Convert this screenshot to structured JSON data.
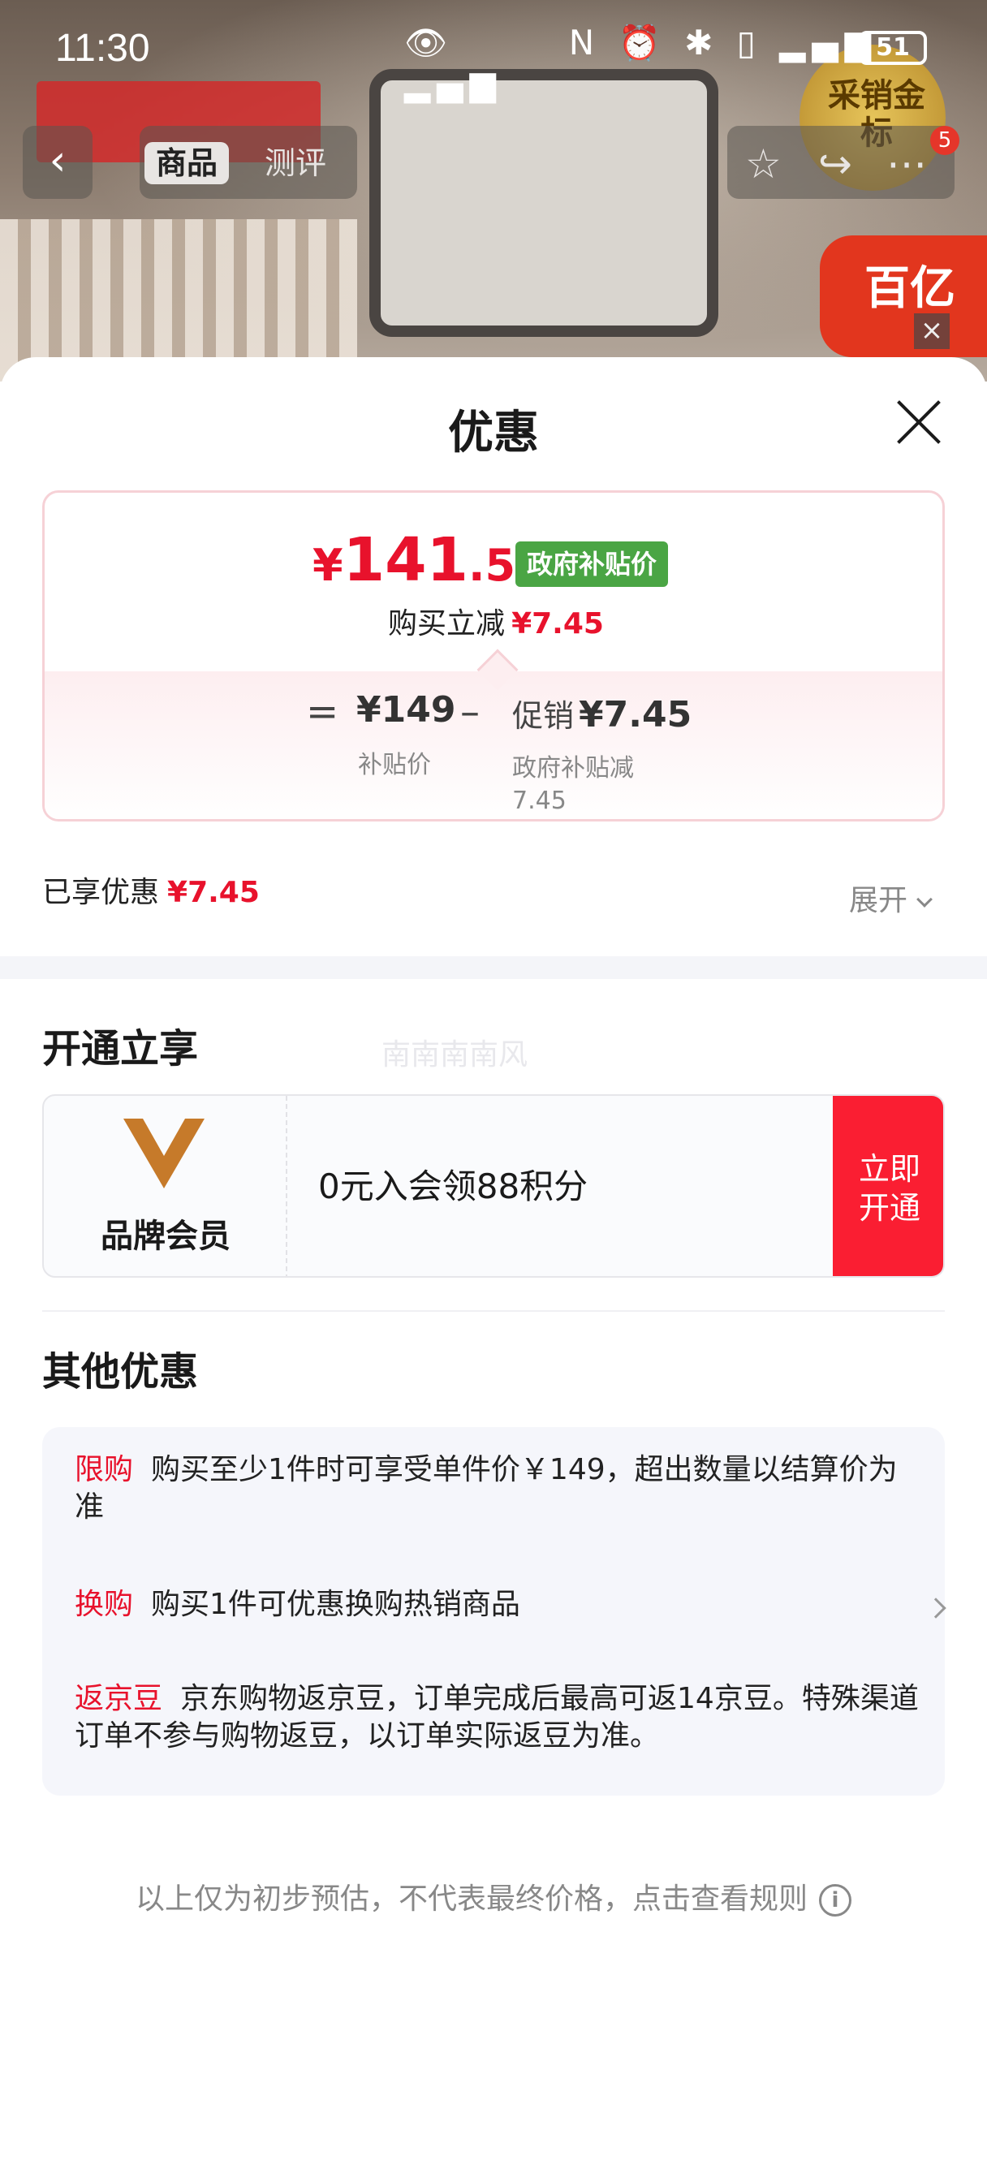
{
  "status_bar": {
    "time": "11:30",
    "battery": "51"
  },
  "top_nav": {
    "tabs": [
      "商品",
      "测评"
    ],
    "badge_count": "5"
  },
  "background": {
    "gold_badge_text": "采销金标",
    "promo_logo_text": "百亿"
  },
  "sheet": {
    "title": "优惠",
    "price": {
      "yen": "¥",
      "integer": "141",
      "decimal": ".55",
      "badge": "政府补贴价"
    },
    "instant_reduction": {
      "label": "购买立减",
      "amount": "¥7.45"
    },
    "breakdown": {
      "equals": "=",
      "base_price": "¥149",
      "base_label": "补贴价",
      "minus": "–",
      "promo_label": "促销",
      "promo_amount": "¥7.45",
      "promo_detail": "政府补贴减 7.45"
    },
    "enjoyed": {
      "label": "已享优惠",
      "amount": "¥7.45"
    },
    "expand_label": "展开",
    "membership": {
      "section_title": "开通立享",
      "watermark": "南南南南风",
      "name": "品牌会员",
      "offer": "0元入会领88积分",
      "button_line1": "立即",
      "button_line2": "开通"
    },
    "other": {
      "section_title": "其他优惠",
      "items": [
        {
          "tag": "限购",
          "text": "购买至少1件时可享受单件价￥149，超出数量以结算价为准"
        },
        {
          "tag": "换购",
          "text": "购买1件可优惠换购热销商品"
        },
        {
          "tag": "返京豆",
          "text": "京东购物返京豆，订单完成后最高可返14京豆。特殊渠道订单不参与购物返豆，以订单实际返豆为准。"
        }
      ]
    },
    "footnote": "以上仅为初步预估，不代表最终价格，点击查看规则"
  }
}
